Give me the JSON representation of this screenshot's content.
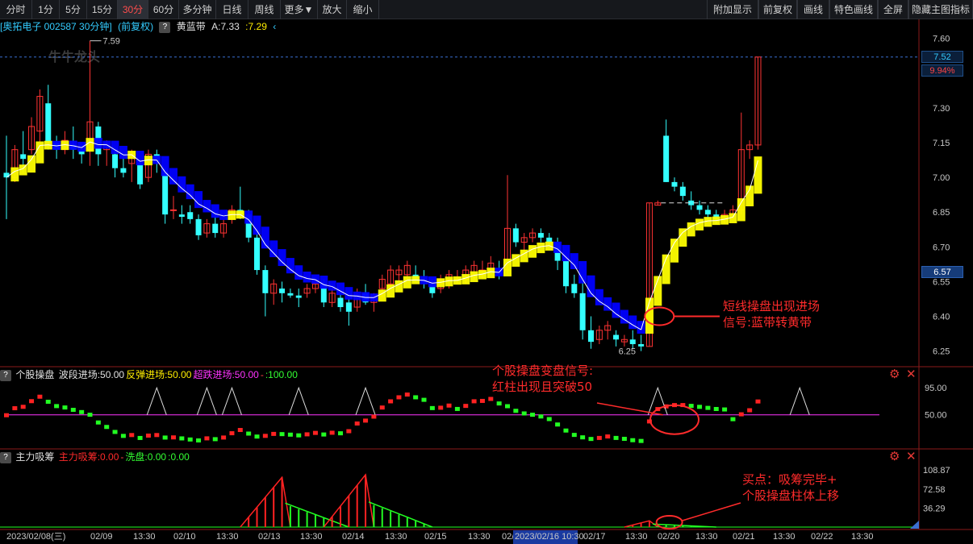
{
  "toolbar": {
    "left_items": [
      "分时",
      "1分",
      "5分",
      "15分",
      "30分",
      "60分",
      "多分钟",
      "日线",
      "周线",
      "更多▼",
      "放大",
      "缩小"
    ],
    "active": "30分",
    "right_items": [
      "附加显示",
      "前复权",
      "画线",
      "特色画线",
      "全屏",
      "隐藏主图指标"
    ]
  },
  "stock": {
    "name_code": "[奥拓电子 002587 30分钟]",
    "adjust": "(前复权)",
    "indicator_name": "黄蓝带",
    "indicator_a": "A:7.33",
    "indicator_b": ":7.29"
  },
  "watermark": "牛牛龙头",
  "main_axis": {
    "ticks": [
      "7.60",
      "7.45",
      "7.30",
      "7.15",
      "7.00",
      "6.85",
      "6.70",
      "6.55",
      "6.40",
      "6.25"
    ],
    "tag_top": "7.52",
    "tag_pct": "9.94%",
    "tag_cursor": "6.57",
    "high_label": "7.59",
    "low_label": "6.25"
  },
  "sub1": {
    "title": "个股操盘",
    "items": [
      {
        "text": "波段进场:50.00",
        "color": "#e0e0e0"
      },
      {
        "text": "反弹进场:50.00",
        "color": "#ffee00"
      },
      {
        "text": "超跌进场:50.00",
        "color": "#ff33ff"
      },
      {
        "text": "-",
        "color": "#ff4444"
      },
      {
        "text": ":100.00",
        "color": "#33ff33"
      }
    ],
    "ticks": [
      "95.00",
      "50.00"
    ]
  },
  "sub2": {
    "title": "主力吸筹",
    "items": [
      {
        "text": "主力吸筹:0.00",
        "color": "#ff2b2b"
      },
      {
        "text": "-",
        "color": "#ff4444"
      },
      {
        "text": "洗盘:0.00",
        "color": "#33ff33"
      },
      {
        "text": ":0.00",
        "color": "#33ff33"
      }
    ],
    "ticks": [
      "108.87",
      "72.58",
      "36.29"
    ]
  },
  "xaxis": {
    "labels": [
      "2023/02/08(三)",
      "02/09",
      "13:30",
      "02/10",
      "13:30",
      "02/13",
      "13:30",
      "02/14",
      "13:30",
      "02/15",
      "13:30",
      "02/16",
      "13:30",
      "02/17",
      "13:30",
      "02/20",
      "13:30",
      "02/21",
      "13:30",
      "02/22",
      "13:30"
    ],
    "cursor_label": "2023/02/16 10:30"
  },
  "annotations": {
    "entry_signal": [
      "短线操盘出现进场",
      "信号:蓝带转黄带"
    ],
    "change_signal": [
      "个股操盘变盘信号:",
      "红柱出现且突破50"
    ],
    "buy_point": [
      "买点：吸筹完毕+",
      "个股操盘柱体上移"
    ]
  },
  "colors": {
    "up": "#ff3333",
    "down": "#33ffff",
    "yellow_band": "#ffff00",
    "blue_band": "#0000ff",
    "accent_red": "#ff2b2b"
  },
  "chart_data": {
    "type": "candlestick",
    "series": [
      {
        "o": 7.02,
        "h": 7.18,
        "l": 6.82,
        "c": 7.0
      },
      {
        "o": 7.0,
        "h": 7.14,
        "l": 6.98,
        "c": 7.12
      },
      {
        "o": 7.1,
        "h": 7.2,
        "l": 7.02,
        "c": 7.08
      },
      {
        "o": 7.12,
        "h": 7.26,
        "l": 7.1,
        "c": 7.22
      },
      {
        "o": 7.2,
        "h": 7.38,
        "l": 7.15,
        "c": 7.35
      },
      {
        "o": 7.32,
        "h": 7.4,
        "l": 7.12,
        "c": 7.15
      },
      {
        "o": 7.15,
        "h": 7.18,
        "l": 7.08,
        "c": 7.12
      },
      {
        "o": 7.12,
        "h": 7.2,
        "l": 7.1,
        "c": 7.16
      },
      {
        "o": 7.14,
        "h": 7.22,
        "l": 7.08,
        "c": 7.12
      },
      {
        "o": 7.12,
        "h": 7.14,
        "l": 7.06,
        "c": 7.1
      },
      {
        "o": 7.12,
        "h": 7.59,
        "l": 7.05,
        "c": 7.24
      },
      {
        "o": 7.22,
        "h": 7.24,
        "l": 7.05,
        "c": 7.1
      },
      {
        "o": 7.12,
        "h": 7.16,
        "l": 7.05,
        "c": 7.14
      },
      {
        "o": 7.1,
        "h": 7.12,
        "l": 7.0,
        "c": 7.04
      },
      {
        "o": 7.04,
        "h": 7.1,
        "l": 7.0,
        "c": 7.02
      },
      {
        "o": 7.06,
        "h": 7.12,
        "l": 6.98,
        "c": 7.1
      },
      {
        "o": 7.06,
        "h": 7.08,
        "l": 6.95,
        "c": 6.97
      },
      {
        "o": 7.0,
        "h": 7.12,
        "l": 6.98,
        "c": 7.1
      },
      {
        "o": 7.1,
        "h": 7.12,
        "l": 7.02,
        "c": 7.07
      },
      {
        "o": 7.02,
        "h": 7.04,
        "l": 6.8,
        "c": 6.84
      },
      {
        "o": 6.86,
        "h": 6.92,
        "l": 6.82,
        "c": 6.86
      },
      {
        "o": 6.84,
        "h": 6.88,
        "l": 6.8,
        "c": 6.83
      },
      {
        "o": 6.85,
        "h": 6.88,
        "l": 6.8,
        "c": 6.82
      },
      {
        "o": 6.82,
        "h": 6.84,
        "l": 6.73,
        "c": 6.75
      },
      {
        "o": 6.76,
        "h": 6.82,
        "l": 6.74,
        "c": 6.8
      },
      {
        "o": 6.8,
        "h": 6.84,
        "l": 6.74,
        "c": 6.76
      },
      {
        "o": 6.76,
        "h": 6.82,
        "l": 6.74,
        "c": 6.8
      },
      {
        "o": 6.82,
        "h": 6.88,
        "l": 6.8,
        "c": 6.86
      },
      {
        "o": 6.86,
        "h": 6.96,
        "l": 6.82,
        "c": 6.84
      },
      {
        "o": 6.84,
        "h": 6.86,
        "l": 6.72,
        "c": 6.74
      },
      {
        "o": 6.74,
        "h": 6.78,
        "l": 6.58,
        "c": 6.6
      },
      {
        "o": 6.6,
        "h": 6.62,
        "l": 6.4,
        "c": 6.5
      },
      {
        "o": 6.5,
        "h": 6.56,
        "l": 6.45,
        "c": 6.54
      },
      {
        "o": 6.52,
        "h": 6.55,
        "l": 6.46,
        "c": 6.5
      },
      {
        "o": 6.5,
        "h": 6.52,
        "l": 6.48,
        "c": 6.49
      },
      {
        "o": 6.49,
        "h": 6.52,
        "l": 6.44,
        "c": 6.48
      },
      {
        "o": 6.5,
        "h": 6.54,
        "l": 6.48,
        "c": 6.52
      },
      {
        "o": 6.52,
        "h": 6.56,
        "l": 6.5,
        "c": 6.54
      },
      {
        "o": 6.54,
        "h": 6.56,
        "l": 6.44,
        "c": 6.46
      },
      {
        "o": 6.46,
        "h": 6.52,
        "l": 6.44,
        "c": 6.5
      },
      {
        "o": 6.48,
        "h": 6.5,
        "l": 6.42,
        "c": 6.44
      },
      {
        "o": 6.46,
        "h": 6.48,
        "l": 6.36,
        "c": 6.42
      },
      {
        "o": 6.44,
        "h": 6.52,
        "l": 6.42,
        "c": 6.48
      },
      {
        "o": 6.5,
        "h": 6.54,
        "l": 6.45,
        "c": 6.46
      },
      {
        "o": 6.46,
        "h": 6.5,
        "l": 6.42,
        "c": 6.48
      },
      {
        "o": 6.52,
        "h": 6.58,
        "l": 6.48,
        "c": 6.56
      },
      {
        "o": 6.54,
        "h": 6.62,
        "l": 6.52,
        "c": 6.6
      },
      {
        "o": 6.58,
        "h": 6.62,
        "l": 6.55,
        "c": 6.6
      },
      {
        "o": 6.58,
        "h": 6.64,
        "l": 6.56,
        "c": 6.62
      },
      {
        "o": 6.58,
        "h": 6.62,
        "l": 6.55,
        "c": 6.56
      },
      {
        "o": 6.56,
        "h": 6.6,
        "l": 6.52,
        "c": 6.55
      },
      {
        "o": 6.54,
        "h": 6.56,
        "l": 6.48,
        "c": 6.5
      },
      {
        "o": 6.52,
        "h": 6.58,
        "l": 6.5,
        "c": 6.56
      },
      {
        "o": 6.56,
        "h": 6.6,
        "l": 6.52,
        "c": 6.58
      },
      {
        "o": 6.56,
        "h": 6.6,
        "l": 6.54,
        "c": 6.56
      },
      {
        "o": 6.56,
        "h": 6.62,
        "l": 6.54,
        "c": 6.6
      },
      {
        "o": 6.58,
        "h": 6.64,
        "l": 6.56,
        "c": 6.62
      },
      {
        "o": 6.6,
        "h": 6.64,
        "l": 6.56,
        "c": 6.6
      },
      {
        "o": 6.6,
        "h": 6.66,
        "l": 6.58,
        "c": 6.63
      },
      {
        "o": 6.6,
        "h": 6.64,
        "l": 6.56,
        "c": 6.58
      },
      {
        "o": 6.6,
        "h": 7.01,
        "l": 6.58,
        "c": 6.78
      },
      {
        "o": 6.78,
        "h": 6.8,
        "l": 6.7,
        "c": 6.72
      },
      {
        "o": 6.72,
        "h": 6.76,
        "l": 6.68,
        "c": 6.74
      },
      {
        "o": 6.74,
        "h": 6.78,
        "l": 6.72,
        "c": 6.76
      },
      {
        "o": 6.76,
        "h": 6.78,
        "l": 6.72,
        "c": 6.74
      },
      {
        "o": 6.74,
        "h": 6.76,
        "l": 6.7,
        "c": 6.72
      },
      {
        "o": 6.72,
        "h": 6.74,
        "l": 6.6,
        "c": 6.64
      },
      {
        "o": 6.64,
        "h": 6.66,
        "l": 6.5,
        "c": 6.53
      },
      {
        "o": 6.54,
        "h": 6.58,
        "l": 6.48,
        "c": 6.5
      },
      {
        "o": 6.5,
        "h": 6.56,
        "l": 6.3,
        "c": 6.34
      },
      {
        "o": 6.34,
        "h": 6.4,
        "l": 6.26,
        "c": 6.29
      },
      {
        "o": 6.3,
        "h": 6.36,
        "l": 6.28,
        "c": 6.34
      },
      {
        "o": 6.34,
        "h": 6.38,
        "l": 6.3,
        "c": 6.36
      },
      {
        "o": 6.32,
        "h": 6.34,
        "l": 6.27,
        "c": 6.3
      },
      {
        "o": 6.29,
        "h": 6.32,
        "l": 6.27,
        "c": 6.3
      },
      {
        "o": 6.3,
        "h": 6.34,
        "l": 6.26,
        "c": 6.28
      },
      {
        "o": 6.28,
        "h": 6.32,
        "l": 6.25,
        "c": 6.27
      },
      {
        "o": 6.27,
        "h": 6.89,
        "l": 6.27,
        "c": 6.89
      },
      {
        "o": 6.88,
        "h": 6.9,
        "l": 6.88,
        "c": 6.89
      },
      {
        "o": 7.18,
        "h": 7.25,
        "l": 6.98,
        "c": 6.98
      },
      {
        "o": 6.98,
        "h": 7.0,
        "l": 6.94,
        "c": 6.96
      },
      {
        "o": 6.96,
        "h": 6.98,
        "l": 6.9,
        "c": 6.92
      },
      {
        "o": 6.9,
        "h": 6.94,
        "l": 6.86,
        "c": 6.88
      },
      {
        "o": 6.88,
        "h": 6.9,
        "l": 6.84,
        "c": 6.86
      },
      {
        "o": 6.86,
        "h": 6.88,
        "l": 6.82,
        "c": 6.84
      },
      {
        "o": 6.84,
        "h": 6.86,
        "l": 6.8,
        "c": 6.82
      },
      {
        "o": 6.82,
        "h": 6.86,
        "l": 6.8,
        "c": 6.84
      },
      {
        "o": 6.84,
        "h": 6.88,
        "l": 6.82,
        "c": 6.86
      },
      {
        "o": 6.86,
        "h": 7.28,
        "l": 6.84,
        "c": 7.12
      },
      {
        "o": 7.12,
        "h": 7.16,
        "l": 7.08,
        "c": 7.14
      },
      {
        "o": 7.14,
        "h": 7.52,
        "l": 7.12,
        "c": 7.52
      }
    ]
  }
}
